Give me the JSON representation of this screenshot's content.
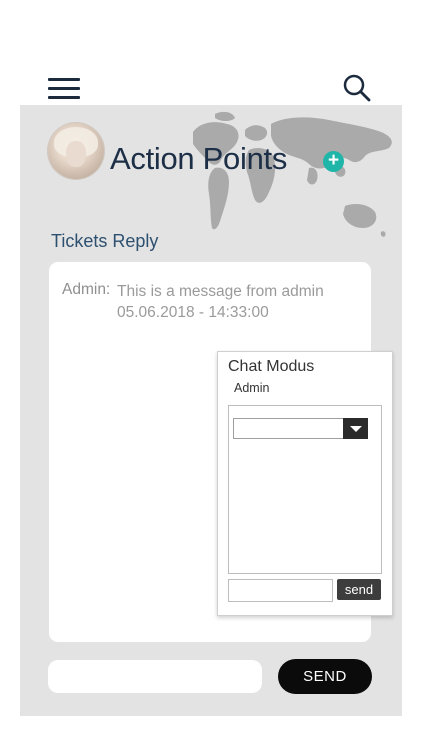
{
  "header": {
    "menu_icon": "hamburger-menu-icon",
    "search_icon": "search-icon"
  },
  "profile": {
    "title": "Action Points",
    "add_icon": "plus-icon",
    "add_symbol": "+"
  },
  "tickets": {
    "label": "Tickets Reply",
    "messages": [
      {
        "author": "Admin:",
        "text": "This is a message from admin",
        "timestamp": "05.06.2018 - 14:33:00"
      }
    ]
  },
  "chat": {
    "title": "Chat Modus",
    "user": "Admin",
    "select_value": "",
    "input_value": "",
    "send_label": "send"
  },
  "reply": {
    "input_value": "",
    "send_label": "SEND"
  },
  "colors": {
    "accent": "#1fb5a8",
    "panel": "#e3e3e3",
    "dark": "#0b0b0b",
    "title": "#1c2f47"
  }
}
